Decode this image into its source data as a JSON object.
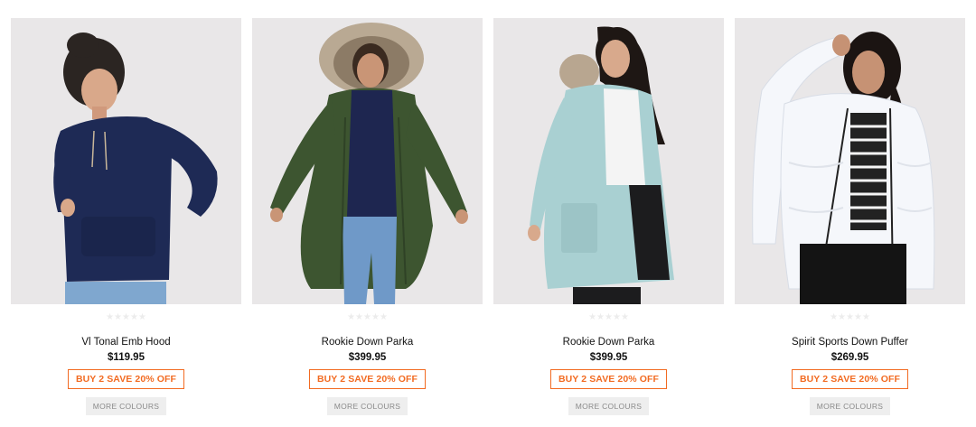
{
  "products": [
    {
      "name": "Vl Tonal Emb Hood",
      "price": "$119.95",
      "promo": "BUY 2 SAVE 20% OFF",
      "more_colours": "MORE COLOURS",
      "rating_stars": "★★★★★",
      "garment": "navy hoodie",
      "colors": {
        "garment": "#1e2a55",
        "pants": "#7fa7cf",
        "hair": "#2b2522"
      }
    },
    {
      "name": "Rookie Down Parka",
      "price": "$399.95",
      "promo": "BUY 2 SAVE 20% OFF",
      "more_colours": "MORE COLOURS",
      "rating_stars": "★★★★★",
      "garment": "khaki parka with fur hood",
      "colors": {
        "garment": "#3d5530",
        "pants": "#6f99c8",
        "hair": "#3a2a20"
      }
    },
    {
      "name": "Rookie Down Parka",
      "price": "$399.95",
      "promo": "BUY 2 SAVE 20% OFF",
      "more_colours": "MORE COLOURS",
      "rating_stars": "★★★★★",
      "garment": "light blue parka",
      "colors": {
        "garment": "#a9d0d2",
        "pants": "#1c1c1e",
        "hair": "#1e1714"
      }
    },
    {
      "name": "Spirit Sports Down Puffer",
      "price": "$269.95",
      "promo": "BUY 2 SAVE 20% OFF",
      "more_colours": "MORE COLOURS",
      "rating_stars": "★★★★★",
      "garment": "white puffer jacket",
      "colors": {
        "garment": "#f5f7fb",
        "pants": "#141414",
        "hair": "#1b1412"
      }
    }
  ],
  "colors": {
    "accent": "#f26b22",
    "photo_bg": "#e9e7e8",
    "star_empty": "#ececec",
    "more_bg": "#eeeeee"
  }
}
